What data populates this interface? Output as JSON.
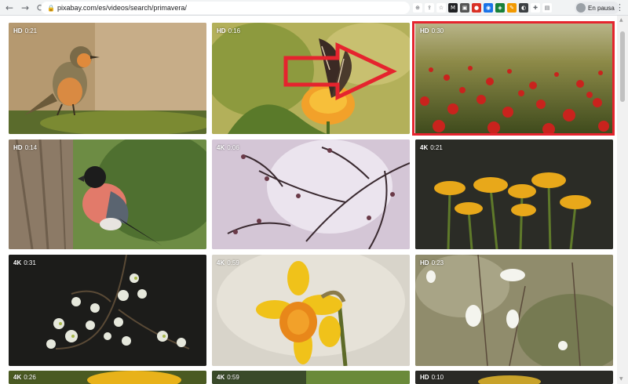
{
  "browser": {
    "url": "pixabay.com/es/videos/search/primavera/",
    "profile_label": "En pausa",
    "back_icon": "←",
    "forward_icon": "→",
    "reload_icon": "⟳"
  },
  "page": {
    "faded_filters_text": ""
  },
  "videos": [
    {
      "quality": "HD",
      "duration": "0:21",
      "subject": "robin-bird"
    },
    {
      "quality": "HD",
      "duration": "0:16",
      "subject": "butterfly-on-flower"
    },
    {
      "quality": "HD",
      "duration": "0:30",
      "subject": "poppy-field"
    },
    {
      "quality": "HD",
      "duration": "0:14",
      "subject": "bullfinch-bird"
    },
    {
      "quality": "4K",
      "duration": "0:06",
      "subject": "cherry-blossom-branches"
    },
    {
      "quality": "4K",
      "duration": "0:21",
      "subject": "dandelions"
    },
    {
      "quality": "4K",
      "duration": "0:31",
      "subject": "white-blossoms"
    },
    {
      "quality": "4K",
      "duration": "0:59",
      "subject": "daffodil"
    },
    {
      "quality": "HD",
      "duration": "0:23",
      "subject": "white-butterflies"
    },
    {
      "quality": "4K",
      "duration": "0:26",
      "subject": "partial"
    },
    {
      "quality": "4K",
      "duration": "0:59",
      "subject": "partial"
    },
    {
      "quality": "HD",
      "duration": "0:10",
      "subject": "partial"
    }
  ],
  "colors": {
    "highlight": "#e5242e",
    "arrow": "#e5242e"
  }
}
